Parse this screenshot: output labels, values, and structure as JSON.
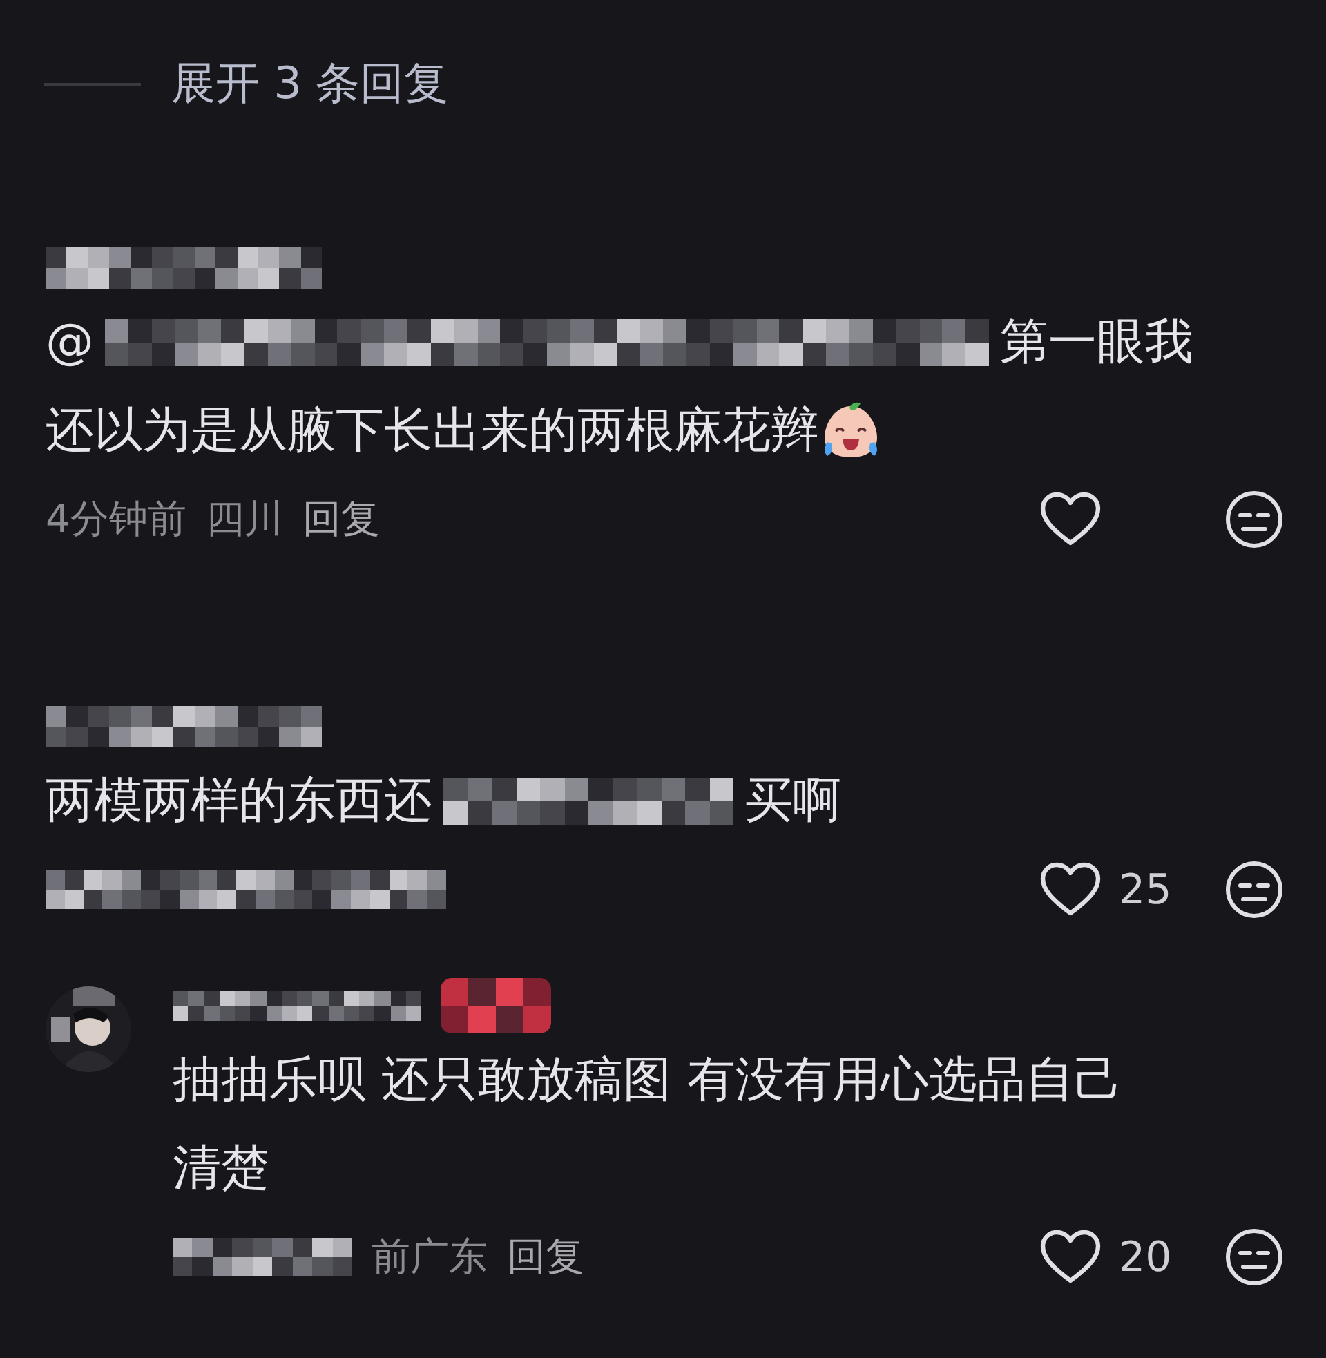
{
  "expand_replies": {
    "label": "展开 3 条回复"
  },
  "comments": [
    {
      "kind": "comment",
      "author": {
        "kind": "redacted"
      },
      "body": [
        [
          {
            "kind": "text",
            "text": "@"
          },
          {
            "kind": "redacted"
          },
          {
            "kind": "text",
            "text": "第一眼我"
          }
        ],
        [
          {
            "kind": "text",
            "text": "还以为是从腋下长出来的两根麻花辫"
          },
          {
            "kind": "emoji"
          }
        ]
      ],
      "meta": [
        {
          "kind": "text",
          "text": "4分钟前"
        },
        {
          "kind": "text",
          "text": "四川"
        },
        {
          "kind": "reply",
          "text": "回复"
        }
      ]
    },
    {
      "kind": "comment",
      "author": {
        "kind": "redacted"
      },
      "body": [
        [
          {
            "kind": "text",
            "text": "两模两样的东西还"
          },
          {
            "kind": "redacted"
          },
          {
            "kind": "text",
            "text": "买啊"
          }
        ]
      ],
      "meta": [
        {
          "kind": "redacted"
        }
      ],
      "likes": "25"
    },
    {
      "kind": "reply",
      "author": {
        "kind": "redacted"
      },
      "avatar": {
        "kind": "picture"
      },
      "author_badge": {
        "kind": "redacted"
      },
      "body": [
        [
          {
            "kind": "text",
            "text": "抽抽乐呗 还只敢放稿图 有没有用心选品自己"
          }
        ],
        [
          {
            "kind": "text",
            "text": "清楚"
          }
        ]
      ],
      "meta": [
        {
          "kind": "redacted"
        },
        {
          "kind": "text",
          "text": "前广东"
        },
        {
          "kind": "reply",
          "text": "回复"
        }
      ],
      "likes": "20"
    }
  ]
}
